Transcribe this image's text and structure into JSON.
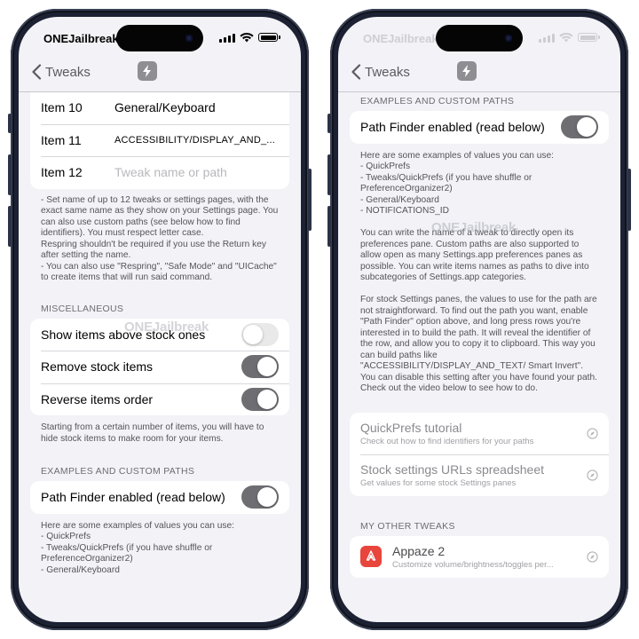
{
  "status_bar": {
    "carrier": "ONEJailbreak"
  },
  "nav": {
    "back_label": "Tweaks",
    "app_icon": "lightning-icon"
  },
  "watermark": "ONEJailbreak",
  "left": {
    "items": [
      {
        "key": "Item 10",
        "value": "General/Keyboard"
      },
      {
        "key": "Item 11",
        "value": "ACCESSIBILITY/DISPLAY_AND_..."
      },
      {
        "key": "Item 12",
        "value": "",
        "placeholder": "Tweak name or path"
      }
    ],
    "items_footer": "- Set name of up to 12 tweaks or settings pages, with the exact same name as they show on your Settings page. You can also use custom paths (see below how to find identifiers). You must respect letter case.\nRespring shouldn't be required if you use the Return key after setting the name.\n- You can also use \"Respring\", \"Safe Mode\" and \"UICache\" to create items that will run said command.",
    "misc_header": "MISCELLANEOUS",
    "misc": [
      {
        "label": "Show items above stock ones",
        "on": false
      },
      {
        "label": "Remove stock items",
        "on": true
      },
      {
        "label": "Reverse items order",
        "on": true
      }
    ],
    "misc_footer": "Starting from a certain number of items, you will have to hide stock items to make room for your items.",
    "paths_header": "EXAMPLES AND CUSTOM PATHS",
    "path_finder": {
      "label": "Path Finder enabled (read below)",
      "on": true
    },
    "paths_footer": "Here are some examples of values you can use:\n- QuickPrefs\n- Tweaks/QuickPrefs (if you have shuffle or PreferenceOrganizer2)\n- General/Keyboard"
  },
  "right": {
    "paths_header": "EXAMPLES AND CUSTOM PATHS",
    "path_finder": {
      "label": "Path Finder enabled (read below)",
      "on": true
    },
    "paths_footer": "Here are some examples of values you can use:\n- QuickPrefs\n- Tweaks/QuickPrefs (if you have shuffle or PreferenceOrganizer2)\n- General/Keyboard\n- NOTIFICATIONS_ID\n\nYou can write the name of a tweak to directly open its preferences pane. Custom paths are also supported to allow open as many Settings.app preferences panes as possible. You can write items names as paths to dive into subcategories of Settings.app categories.\n\nFor stock Settings panes, the values to use for the path are not straightforward. To find out the path you want, enable \"Path Finder\" option above, and long press rows you're interested in to build the path. It will reveal the identifier of the row, and allow you to copy it to clipboard. This way you can build paths like \"ACCESSIBILITY/DISPLAY_AND_TEXT/ Smart Invert\". You can disable this setting after you have found your path. Check out the video below to see how to do.",
    "links": [
      {
        "title": "QuickPrefs tutorial",
        "subtitle": "Check out how to find identifiers for your paths",
        "icon": "safari-icon"
      },
      {
        "title": "Stock settings URLs spreadsheet",
        "subtitle": "Get values for some stock Settings panes",
        "icon": "safari-icon"
      }
    ],
    "other_header": "MY OTHER TWEAKS",
    "other_tweak": {
      "title": "Appaze 2",
      "subtitle": "Customize volume/brightness/toggles per...",
      "icon": "appaze-icon"
    }
  },
  "colors": {
    "toggle_on": "#6d6d72",
    "toggle_off": "#e9e9ea",
    "background": "#f2f2f7",
    "phone_frame": "#1c2233"
  }
}
